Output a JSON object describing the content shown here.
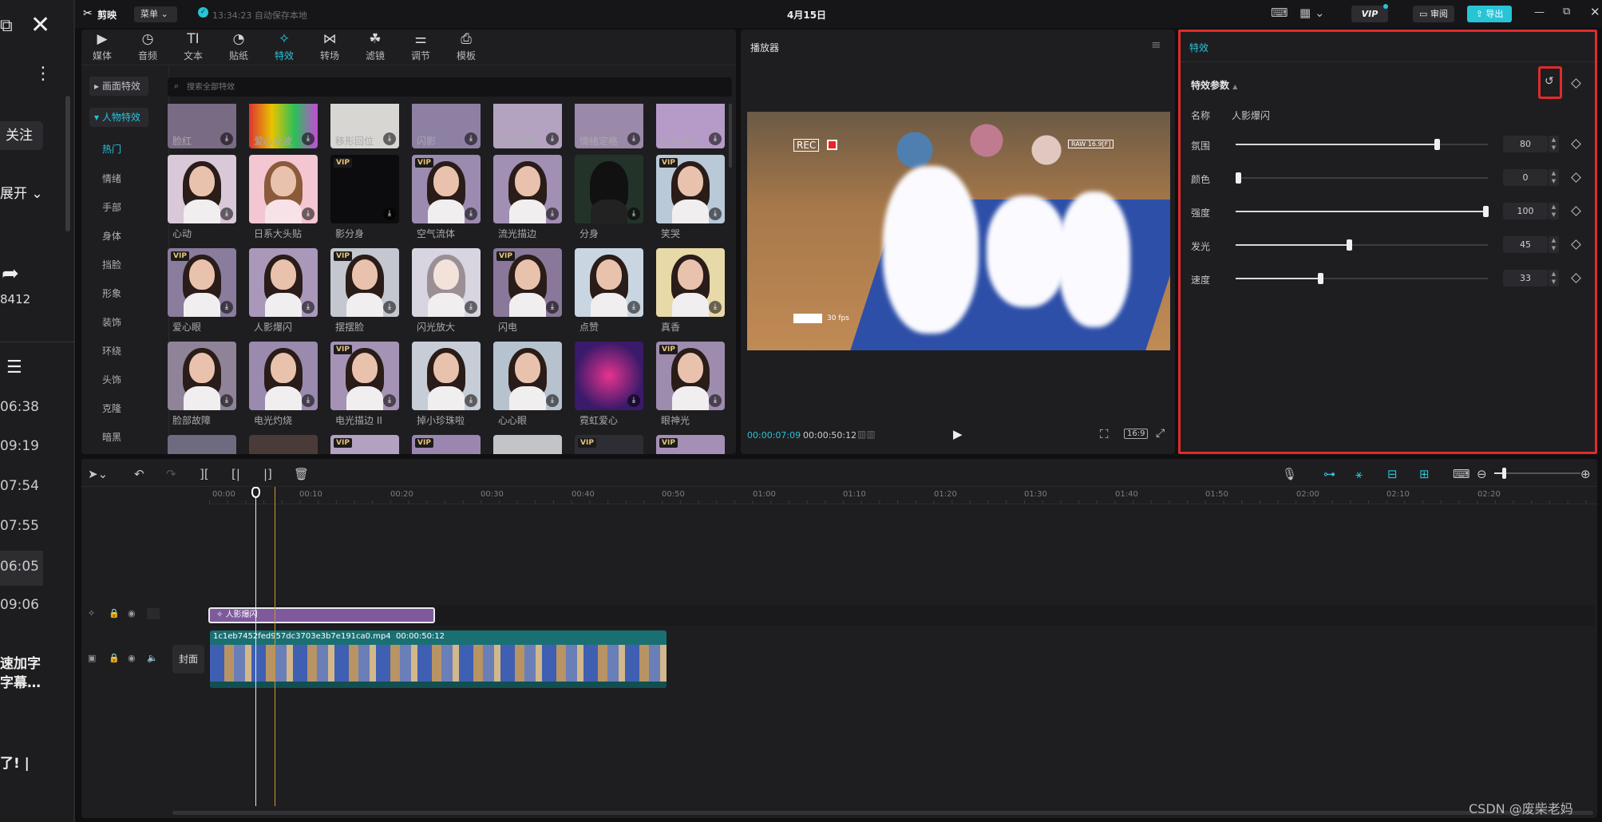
{
  "app": {
    "name": "剪映",
    "menu_label": "菜单",
    "autosave_text": "13:34:23 自动保存本地",
    "project_date": "4月15日",
    "vip_label": "VIP",
    "review_label": "审阅",
    "export_label": "导出"
  },
  "left_strip": {
    "follow_label": "关注",
    "expand_label": "展开",
    "share_count": "8412",
    "times": [
      "06:38",
      "09:19",
      "07:54",
      "07:55",
      "06:05",
      "09:06"
    ],
    "text1": "速加字",
    "text2": "字幕…",
    "text3": "了! |"
  },
  "toolbar": [
    {
      "label": "媒体",
      "icon": "media-icon"
    },
    {
      "label": "音频",
      "icon": "audio-icon"
    },
    {
      "label": "文本",
      "icon": "text-icon"
    },
    {
      "label": "贴纸",
      "icon": "sticker-icon"
    },
    {
      "label": "特效",
      "icon": "effects-icon",
      "active": true
    },
    {
      "label": "转场",
      "icon": "transition-icon"
    },
    {
      "label": "滤镜",
      "icon": "filter-icon"
    },
    {
      "label": "调节",
      "icon": "adjust-icon"
    },
    {
      "label": "模板",
      "icon": "template-icon"
    }
  ],
  "categories": {
    "group1": "画面特效",
    "group2": "人物特效",
    "items": [
      "热门",
      "情绪",
      "手部",
      "身体",
      "挡脸",
      "形象",
      "装饰",
      "环绕",
      "头饰",
      "克隆",
      "暗黑"
    ]
  },
  "search": {
    "placeholder": "搜索全部特效"
  },
  "effects_row0": [
    "脸红",
    "爱心光波",
    "移形回位",
    "闪影",
    "拼贴抽帧",
    "情绪定格",
    "幻彩流光"
  ],
  "effects_row1": [
    "心动",
    "日系大头贴",
    "影分身",
    "空气流体",
    "流光描边",
    "分身",
    "笑哭"
  ],
  "effects_row2": [
    "爱心眼",
    "人影爆闪",
    "摆摆脸",
    "闪光放大",
    "闪电",
    "点赞",
    "真香"
  ],
  "effects_row3": [
    "脸部故障",
    "电光灼烧",
    "电光描边 II",
    "掉小珍珠啦",
    "心心眼",
    "霓虹爱心",
    "眼神光"
  ],
  "player": {
    "title": "播放器",
    "current_time": "00:00:07:09",
    "total_time": "00:00:50:12",
    "ratio": "16:9",
    "rec_label": "REC",
    "fps_label": "30 fps",
    "cam_tag": "RAW 16.9[F]"
  },
  "properties": {
    "panel_title": "特效",
    "section_title": "特效参数",
    "name_label": "名称",
    "name_value": "人影爆闪",
    "params": [
      {
        "label": "氛围",
        "value": "80"
      },
      {
        "label": "颜色",
        "value": "0"
      },
      {
        "label": "强度",
        "value": "100"
      },
      {
        "label": "发光",
        "value": "45"
      },
      {
        "label": "速度",
        "value": "33"
      }
    ]
  },
  "timeline": {
    "ticks": [
      "00:00",
      "00:10",
      "00:20",
      "00:30",
      "00:40",
      "00:50",
      "01:00",
      "01:10",
      "01:20",
      "01:30",
      "01:40",
      "01:50",
      "02:00",
      "02:10",
      "02:20"
    ],
    "effect_clip_label": "人影爆闪",
    "video_clip_label": "1c1eb7452fed957dc3703e3b7e191ca0.mp4",
    "video_clip_duration": "00:00:50:12",
    "cover_label": "封面"
  },
  "watermark": "CSDN @废柴老妈",
  "colors": {
    "accent": "#27c4d6",
    "highlight_red": "#e02b2b",
    "effect_clip": "#7e5a9c",
    "video_clip": "#1a6f73"
  }
}
